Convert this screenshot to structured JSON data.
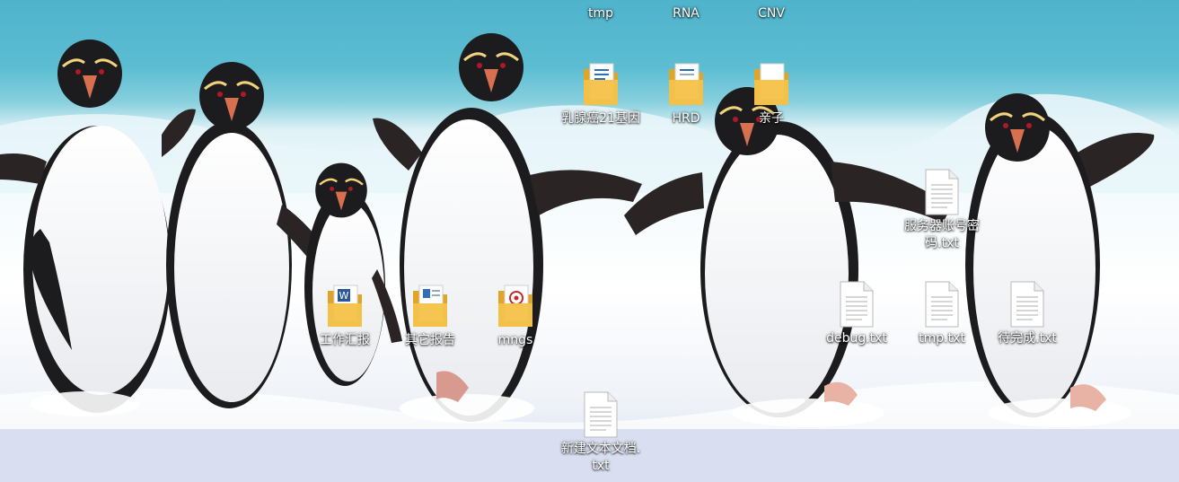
{
  "desktop": {
    "wallpaper": "penguins-on-beach",
    "colors": {
      "sea": "#4fb3cc",
      "foam": "#f4fbfd",
      "sand": "#d6dcee",
      "folder": "#f5c24a",
      "label_text": "#ffffff"
    },
    "icons": [
      {
        "id": "tmp",
        "type": "folder-label-only",
        "label": "tmp"
      },
      {
        "id": "rna",
        "type": "folder-label-only",
        "label": "RNA"
      },
      {
        "id": "cnv",
        "type": "folder-label-only",
        "label": "CNV"
      },
      {
        "id": "breast",
        "type": "folder",
        "icon": "folder-with-blue-doc-icon",
        "label": "乳腺癌21基因"
      },
      {
        "id": "hrd",
        "type": "folder",
        "icon": "folder-with-blue-doc-icon",
        "label": "HRD"
      },
      {
        "id": "qinzi",
        "type": "folder",
        "icon": "folder-with-white-doc-icon",
        "label": "亲子"
      },
      {
        "id": "server",
        "type": "text-file",
        "icon": "text-file-icon",
        "label": "服务器账号密码.txt"
      },
      {
        "id": "work",
        "type": "folder",
        "icon": "folder-with-word-doc-icon",
        "label": "工作汇报"
      },
      {
        "id": "other",
        "type": "folder",
        "icon": "folder-with-doc-icon",
        "label": "其它报告"
      },
      {
        "id": "mngs",
        "type": "folder",
        "icon": "folder-with-red-stamp-doc-icon",
        "label": "mngs"
      },
      {
        "id": "debug",
        "type": "text-file",
        "icon": "text-file-icon",
        "label": "debug.txt"
      },
      {
        "id": "tmptxt",
        "type": "text-file",
        "icon": "text-file-icon",
        "label": "tmp.txt"
      },
      {
        "id": "todo",
        "type": "text-file",
        "icon": "text-file-icon",
        "label": "待完成.txt"
      },
      {
        "id": "newdoc",
        "type": "text-file",
        "icon": "text-file-icon",
        "label": "新建文本文档.txt"
      }
    ]
  }
}
